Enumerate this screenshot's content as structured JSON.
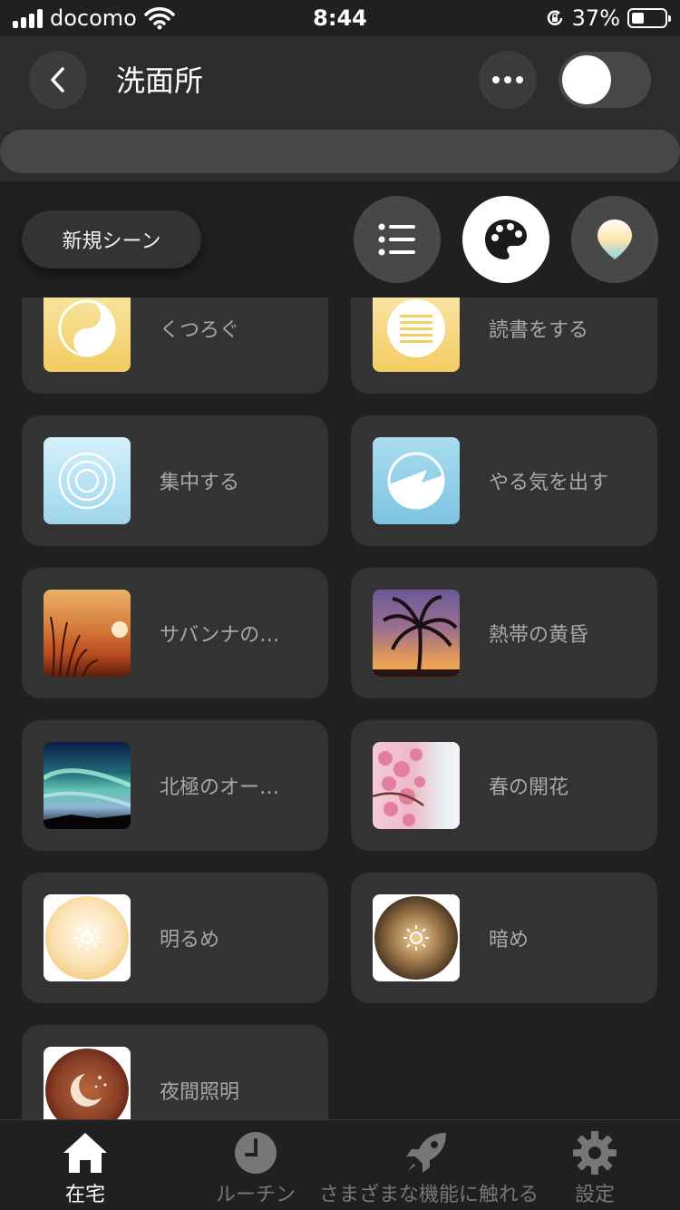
{
  "status_bar": {
    "carrier": "docomo",
    "time": "8:44",
    "battery_percent": "37%",
    "battery_level": 0.37
  },
  "header": {
    "title": "洗面所",
    "power_on": true
  },
  "actions": {
    "new_scene_label": "新規シーン",
    "modes": [
      "list",
      "palette",
      "location"
    ],
    "selected_mode": "palette"
  },
  "scenes": [
    {
      "label": "くつろぐ",
      "icon": "yin-yang-icon"
    },
    {
      "label": "読書をする",
      "icon": "reading-lines-icon"
    },
    {
      "label": "集中する",
      "icon": "concentric-circles-icon"
    },
    {
      "label": "やる気を出す",
      "icon": "energize-circle-icon"
    },
    {
      "label": "サバンナの…",
      "icon": "savanna-sunset-photo"
    },
    {
      "label": "熱帯の黄昏",
      "icon": "tropical-twilight-palm-photo"
    },
    {
      "label": "北極のオー…",
      "icon": "aurora-photo"
    },
    {
      "label": "春の開花",
      "icon": "cherry-blossom-photo"
    },
    {
      "label": "明るめ",
      "icon": "bright-sun-icon"
    },
    {
      "label": "暗め",
      "icon": "dim-sun-icon"
    },
    {
      "label": "夜間照明",
      "icon": "night-moon-icon"
    }
  ],
  "tabbar": {
    "items": [
      {
        "label": "在宅",
        "icon": "home-icon",
        "active": true
      },
      {
        "label": "ルーチン",
        "icon": "clock-icon",
        "active": false
      },
      {
        "label": "さまざまな機能に触れる",
        "icon": "rocket-icon",
        "active": false
      },
      {
        "label": "設定",
        "icon": "gear-icon",
        "active": false
      }
    ]
  },
  "colors": {
    "background": "#202020",
    "card": "#333333",
    "header": "#2c2c2c",
    "active_tab": "#ffffff",
    "inactive_tab": "#777777"
  }
}
